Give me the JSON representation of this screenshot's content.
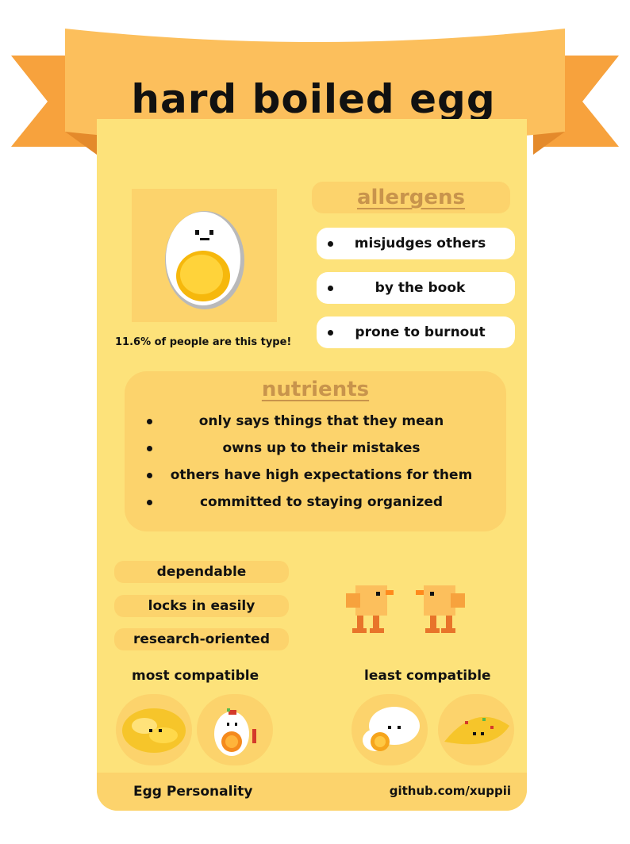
{
  "title": "hard boiled egg",
  "stat": "11.6%  of people are this type!",
  "allergens": {
    "heading": "allergens",
    "items": [
      "misjudges others",
      "by the book",
      "prone to burnout"
    ]
  },
  "nutrients": {
    "heading": "nutrients",
    "items": [
      "only says things that they mean",
      "owns up to their mistakes",
      "others have high expectations for them",
      "committed to staying organized"
    ]
  },
  "traits": [
    "dependable",
    "locks in easily",
    "research-oriented"
  ],
  "compatibility": {
    "most_label": "most compatible",
    "least_label": "least compatible"
  },
  "footer": {
    "left": "Egg Personality",
    "right": "github.com/xuppii"
  },
  "colors": {
    "ribbon": "#fcbf5c",
    "ribbon_tail": "#f7a23d",
    "card": "#fde27a",
    "panel": "#fcd36c",
    "heading": "#c8944c"
  }
}
